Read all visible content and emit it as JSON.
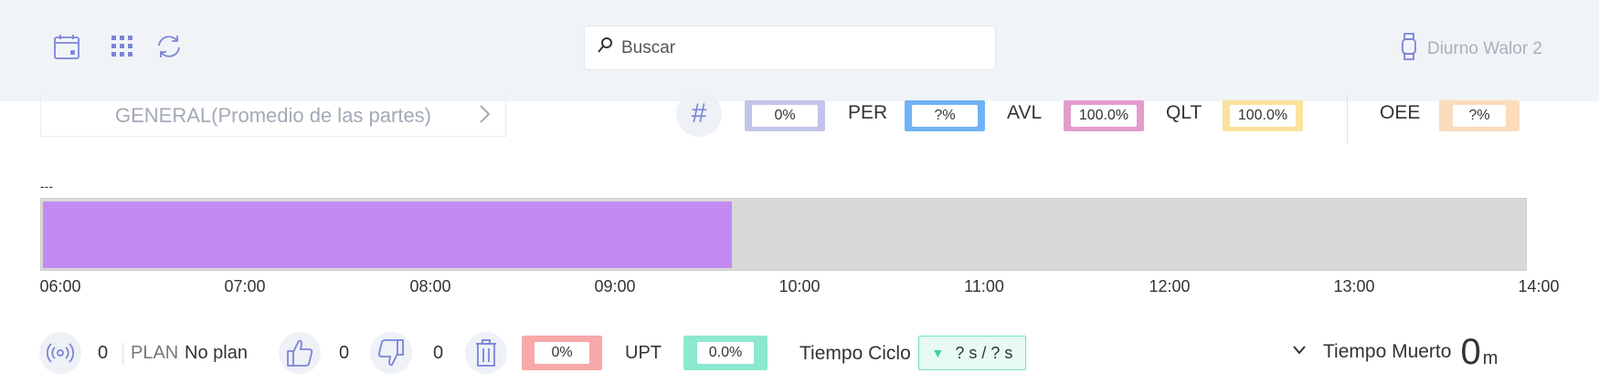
{
  "header": {
    "icons": [
      "calendar-icon",
      "grid-apps-icon",
      "refresh-icon"
    ],
    "search": {
      "placeholder": "Buscar",
      "value": ""
    },
    "user": {
      "name": "Diurno Walor 2",
      "icon": "watch-icon"
    }
  },
  "part_selector": {
    "label": "GENERAL(Promedio de las partes)"
  },
  "metrics": {
    "hash_value": "0%",
    "per": {
      "label": "PER",
      "value": "?%"
    },
    "avl": {
      "label": "AVL",
      "value": "100.0%"
    },
    "qlt": {
      "label": "QLT",
      "value": "100.0%"
    },
    "oee": {
      "label": "OEE",
      "value": "?%"
    }
  },
  "timeline": {
    "label": "---",
    "progress": 0.465,
    "ticks": [
      "06:00",
      "07:00",
      "08:00",
      "09:00",
      "10:00",
      "11:00",
      "12:00",
      "13:00",
      "14:00"
    ]
  },
  "bottom": {
    "signal_count": "0",
    "plan_label": "PLAN",
    "plan_value": "No plan",
    "good_count": "0",
    "bad_count": "0",
    "scrap_pct": "0%",
    "upt_label": "UPT",
    "upt_value": "0.0%",
    "cycle_label": "Tiempo Ciclo",
    "cycle_value": "? s / ? s",
    "dead_label": "Tiempo Muerto",
    "dead_value": "0",
    "dead_unit": "m"
  },
  "colors": {
    "accent": "#7b84d8",
    "hash_box": "#c3c4ec",
    "per_box": "#6fb2f5",
    "avl_box": "#e49ccc",
    "qlt_box": "#fbe29c",
    "oee_box": "#fbdcbc",
    "scrap_box": "#f8a8a8",
    "upt_box": "#8ce8cf",
    "timeline_fill": "#c38bf2"
  }
}
